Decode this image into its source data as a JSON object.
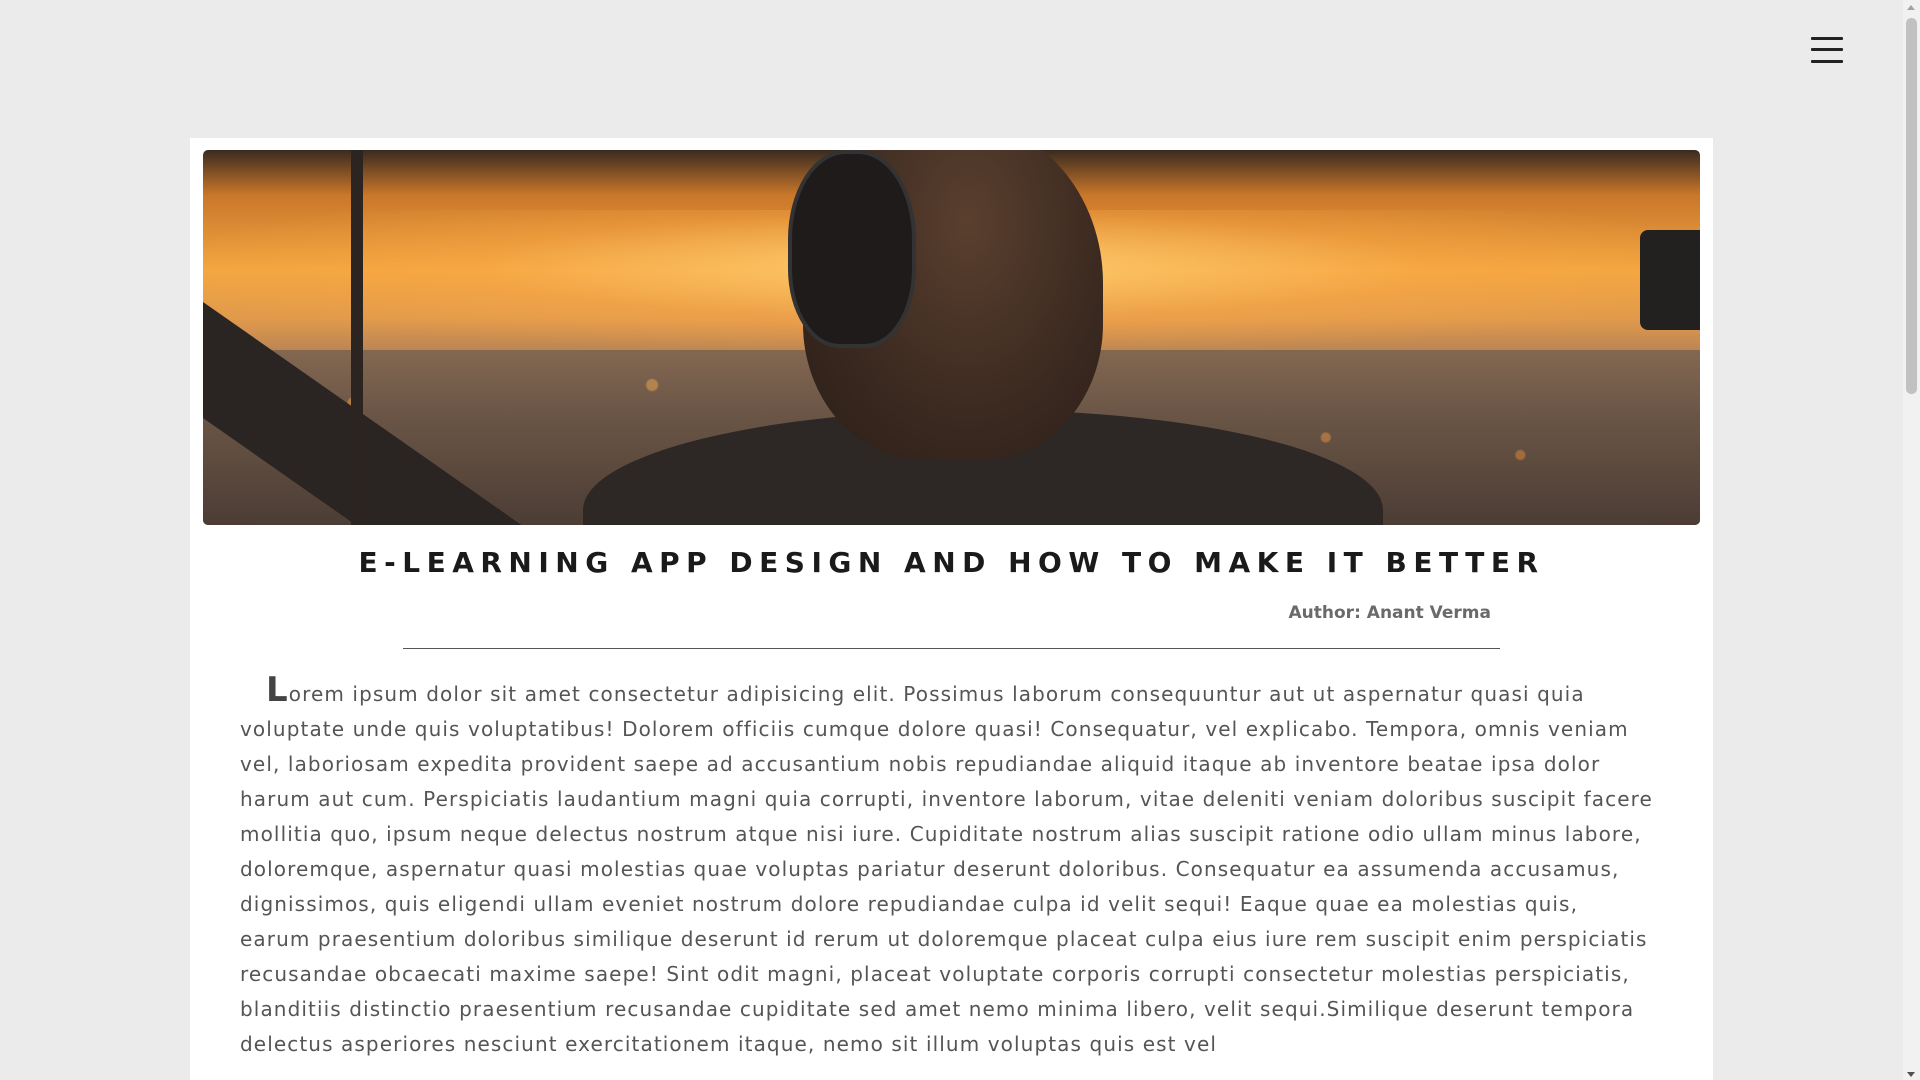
{
  "header": {
    "menu_icon": "hamburger-menu-icon"
  },
  "article": {
    "hero_image_icon": "pilot-headset-sunset-photo",
    "title": "E-LEARNING APP DESIGN AND HOW TO MAKE IT BETTER",
    "author": "Author: Anant Verma",
    "drop_cap": "L",
    "body": "orem ipsum dolor sit amet consectetur adipisicing elit. Possimus laborum consequuntur aut ut aspernatur quasi quia voluptate unde quis voluptatibus! Dolorem officiis cumque dolore quasi! Consequatur, vel explicabo. Tempora, omnis veniam vel, laboriosam expedita provident saepe ad accusantium nobis repudiandae aliquid itaque ab inventore beatae ipsa dolor harum aut cum. Perspiciatis laudantium magni quia corrupti, inventore laborum, vitae deleniti veniam doloribus suscipit facere mollitia quo, ipsum neque delectus nostrum atque nisi iure. Cupiditate nostrum alias suscipit ratione odio ullam minus labore, doloremque, aspernatur quasi molestias quae voluptas pariatur deserunt doloribus. Consequatur ea assumenda accusamus, dignissimos, quis eligendi ullam eveniet nostrum dolore repudiandae culpa id velit sequi! Eaque quae ea molestias quis, earum praesentium doloribus similique deserunt id rerum ut doloremque placeat culpa eius iure rem suscipit enim perspiciatis recusandae obcaecati maxime saepe! Sint odit magni, placeat voluptate corporis corrupti consectetur molestias perspiciatis, blanditiis distinctio praesentium recusandae cupiditate sed amet nemo minima libero, velit sequi.Similique deserunt tempora delectus asperiores nesciunt exercitationem itaque, nemo sit illum voluptas quis est vel"
  },
  "colors": {
    "background": "#ebebeb",
    "card": "#ffffff",
    "title": "#1a1a1a",
    "author": "#6a6a6a",
    "body": "#555555"
  }
}
